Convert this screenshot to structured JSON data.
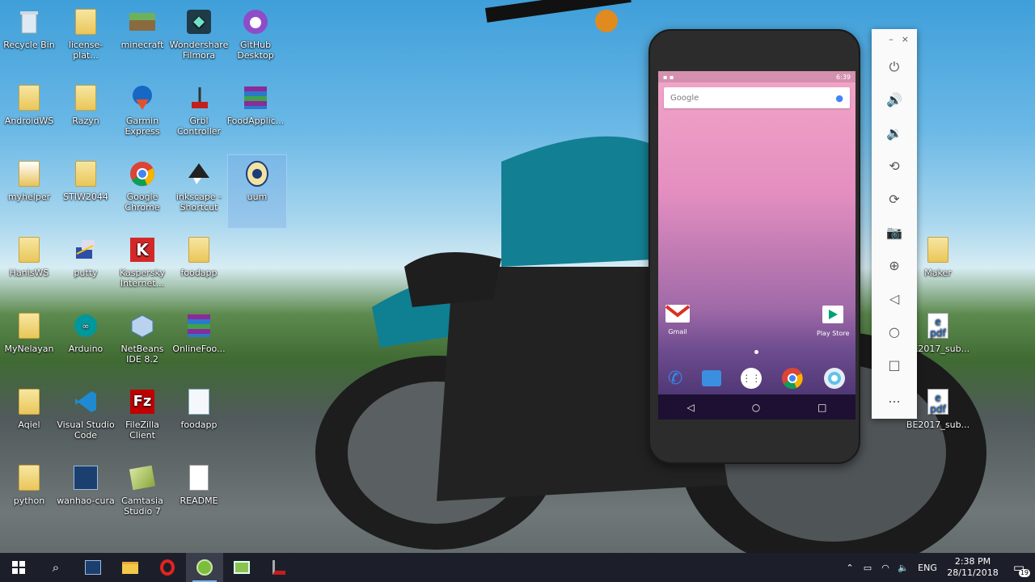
{
  "desktop": {
    "icons": [
      {
        "label": "Recycle Bin",
        "icon": "recycle-bin-icon"
      },
      {
        "label": "license-plat...",
        "icon": "folder-icon"
      },
      {
        "label": "minecraft",
        "icon": "minecraft-icon"
      },
      {
        "label": "Wondershare Filmora",
        "icon": "filmora-icon"
      },
      {
        "label": "GitHub Desktop",
        "icon": "github-icon"
      },
      {
        "label": "AndroidWS",
        "icon": "folder-icon"
      },
      {
        "label": "Razyn",
        "icon": "folder-icon"
      },
      {
        "label": "Garmin Express",
        "icon": "garmin-icon"
      },
      {
        "label": "Grbl Controller",
        "icon": "grbl-icon"
      },
      {
        "label": "FoodApplic...",
        "icon": "winrar-icon"
      },
      {
        "label": "myhelper",
        "icon": "folder-icon"
      },
      {
        "label": "STIW2044",
        "icon": "folder-icon"
      },
      {
        "label": "Google Chrome",
        "icon": "chrome-icon"
      },
      {
        "label": "inkscape - Shortcut",
        "icon": "inkscape-icon"
      },
      {
        "label": "uum",
        "icon": "uum-icon"
      },
      {
        "label": "HanisWS",
        "icon": "folder-icon"
      },
      {
        "label": "putty",
        "icon": "putty-icon"
      },
      {
        "label": "Kaspersky Internet...",
        "icon": "kaspersky-icon"
      },
      {
        "label": "foodapp",
        "icon": "folder-icon"
      },
      {
        "label": "MyNelayan",
        "icon": "folder-icon"
      },
      {
        "label": "Arduino",
        "icon": "arduino-icon"
      },
      {
        "label": "NetBeans IDE 8.2",
        "icon": "netbeans-icon"
      },
      {
        "label": "OnlineFoo...",
        "icon": "winrar-icon"
      },
      {
        "label": "Aqiel",
        "icon": "folder-icon"
      },
      {
        "label": "Visual Studio Code",
        "icon": "vscode-icon"
      },
      {
        "label": "FileZilla Client",
        "icon": "filezilla-icon"
      },
      {
        "label": "foodapp",
        "icon": "document-icon"
      },
      {
        "label": "python",
        "icon": "folder-icon"
      },
      {
        "label": "wanhao-cura",
        "icon": "cura-icon"
      },
      {
        "label": "Camtasia Studio 7",
        "icon": "camtasia-icon"
      },
      {
        "label": "README",
        "icon": "text-file-icon"
      },
      {
        "label": "Maker",
        "icon": "folder-icon"
      },
      {
        "label": "BE2017_sub...",
        "icon": "pdf-icon"
      },
      {
        "label": "BE2017_sub...",
        "icon": "pdf-icon"
      }
    ]
  },
  "emulator": {
    "status_time": "6:39",
    "search_brand": "Google",
    "apps": [
      {
        "label": "Gmail",
        "icon": "gmail-icon"
      },
      {
        "label": "Play Store",
        "icon": "play-store-icon"
      }
    ],
    "hotseat": [
      "phone-icon",
      "messages-icon",
      "app-drawer-icon",
      "chrome-icon",
      "camera-icon"
    ],
    "toolbar": {
      "minimize": "–",
      "close": "×",
      "buttons": [
        "power-icon",
        "volume-up-icon",
        "volume-down-icon",
        "rotate-left-icon",
        "rotate-right-icon",
        "camera-icon",
        "zoom-icon",
        "back-icon",
        "home-icon",
        "overview-icon",
        "more-icon"
      ],
      "more_label": "..."
    }
  },
  "taskbar": {
    "apps": [
      "start-icon",
      "search-icon",
      "wanhao-icon",
      "file-explorer-icon",
      "opera-icon",
      "android-studio-icon",
      "camtasia-icon",
      "grbl-icon"
    ],
    "language": "ENG",
    "time": "2:38 PM",
    "date": "28/11/2018",
    "notifications": "19"
  },
  "colors": {
    "taskbar_bg": "#1c1f2a",
    "phone_screen_top": "#f2a6c8",
    "phone_screen_bottom": "#3f2c66"
  }
}
